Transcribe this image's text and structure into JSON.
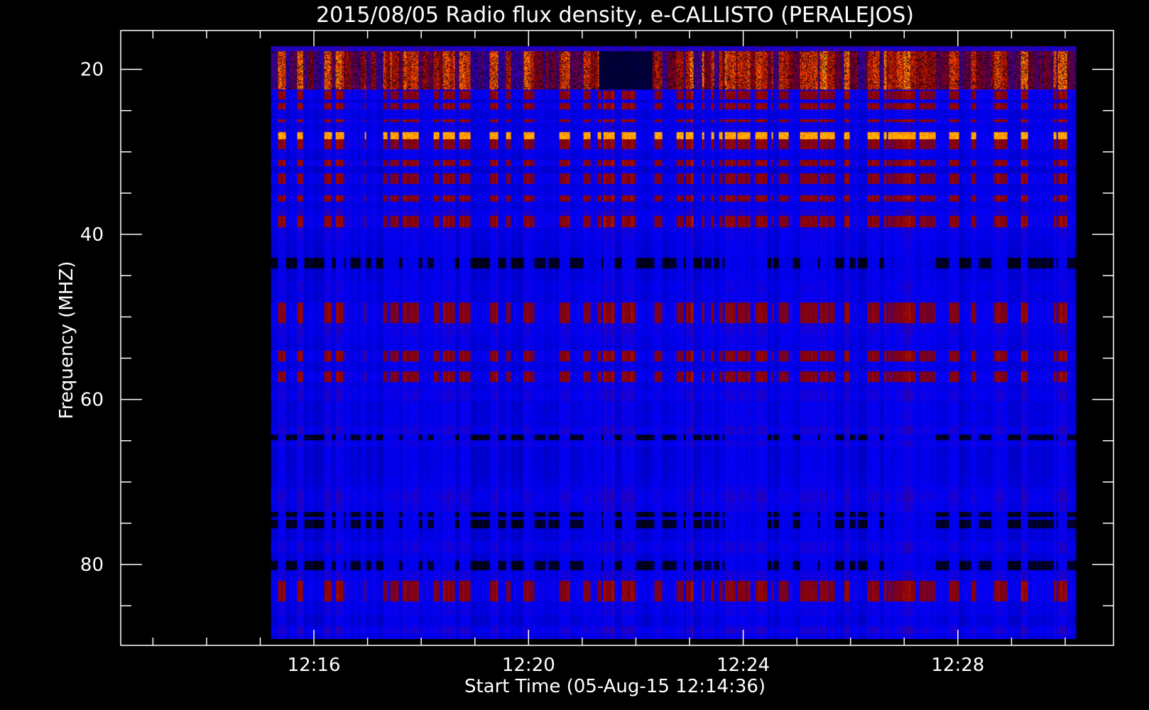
{
  "chart_data": {
    "type": "heatmap",
    "title": "2015/08/05  Radio flux density, e-CALLISTO (PERALEJOS)",
    "xlabel": "Start Time (05-Aug-15 12:14:36)",
    "ylabel": "Frequency (MHZ)",
    "x_range_minutes": [
      12.4,
      30.9
    ],
    "data_extent_minutes": [
      15.2,
      30.2
    ],
    "y_range_mhz": [
      15.3,
      89.8
    ],
    "data_extent_mhz": [
      17.2,
      89.0
    ],
    "y_inverted": true,
    "x_major_ticks": [
      {
        "minute": 16,
        "label": "12:16"
      },
      {
        "minute": 20,
        "label": "12:20"
      },
      {
        "minute": 24,
        "label": "12:24"
      },
      {
        "minute": 28,
        "label": "12:28"
      }
    ],
    "x_minor_step_minutes": 1,
    "y_major_ticks": [
      {
        "value": 20,
        "label": "20"
      },
      {
        "value": 40,
        "label": "40"
      },
      {
        "value": 60,
        "label": "60"
      },
      {
        "value": 80,
        "label": "80"
      }
    ],
    "y_minor_step_mhz": 5,
    "colormap": [
      "#000000",
      "#0000ff",
      "#8b0000",
      "#ff4500",
      "#ffd700",
      "#ffffff"
    ],
    "grid": false,
    "legend": "none"
  }
}
